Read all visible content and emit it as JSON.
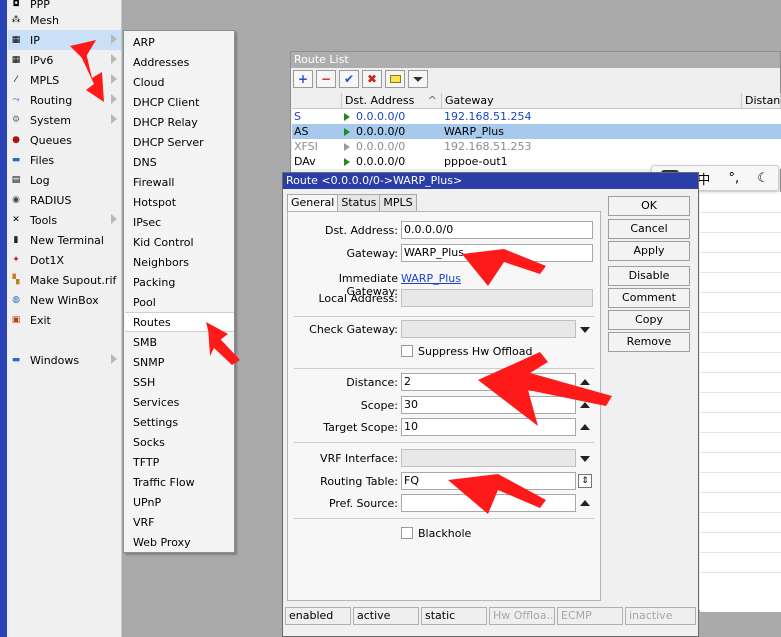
{
  "left_menu": {
    "items": [
      {
        "label": "PPP",
        "icon": "ppp-icon"
      },
      {
        "label": "Mesh",
        "icon": "mesh-icon"
      },
      {
        "label": "IP",
        "icon": "ip-icon",
        "submenu": true
      },
      {
        "label": "IPv6",
        "icon": "ipv6-icon",
        "submenu": true
      },
      {
        "label": "MPLS",
        "icon": "mpls-icon",
        "submenu": true
      },
      {
        "label": "Routing",
        "icon": "routing-icon",
        "submenu": true
      },
      {
        "label": "System",
        "icon": "system-icon",
        "submenu": true
      },
      {
        "label": "Queues",
        "icon": "queues-icon"
      },
      {
        "label": "Files",
        "icon": "files-icon"
      },
      {
        "label": "Log",
        "icon": "log-icon"
      },
      {
        "label": "RADIUS",
        "icon": "radius-icon"
      },
      {
        "label": "Tools",
        "icon": "tools-icon",
        "submenu": true
      },
      {
        "label": "New Terminal",
        "icon": "terminal-icon"
      },
      {
        "label": "Dot1X",
        "icon": "dot1x-icon"
      },
      {
        "label": "Make Supout.rif",
        "icon": "supout-icon"
      },
      {
        "label": "New WinBox",
        "icon": "winbox-icon"
      },
      {
        "label": "Exit",
        "icon": "exit-icon"
      },
      {
        "label": "Windows",
        "icon": "windows-icon",
        "submenu": true
      }
    ]
  },
  "ip_submenu": {
    "items": [
      "ARP",
      "Addresses",
      "Cloud",
      "DHCP Client",
      "DHCP Relay",
      "DHCP Server",
      "DNS",
      "Firewall",
      "Hotspot",
      "IPsec",
      "Kid Control",
      "Neighbors",
      "Packing",
      "Pool",
      "Routes",
      "SMB",
      "SNMP",
      "SSH",
      "Services",
      "Settings",
      "Socks",
      "TFTP",
      "Traffic Flow",
      "UPnP",
      "VRF",
      "Web Proxy"
    ]
  },
  "route_list": {
    "title": "Route List",
    "columns": [
      "",
      "Dst. Address",
      "Gateway",
      "Distance"
    ],
    "rows": [
      {
        "flag": "S",
        "dst": "0.0.0.0/0",
        "gateway": "192.168.51.254"
      },
      {
        "flag": "AS",
        "dst": "0.0.0.0/0",
        "gateway": "WARP_Plus"
      },
      {
        "flag": "XFSI",
        "dst": "0.0.0.0/0",
        "gateway": "192.168.51.253"
      },
      {
        "flag": "DAv",
        "dst": "0.0.0.0/0",
        "gateway": "pppoe-out1"
      }
    ]
  },
  "ime": {
    "logo": "dts",
    "mode": "中",
    "punct": "°,",
    "theme": "moon-icon"
  },
  "route_dialog": {
    "title": "Route <0.0.0.0/0->WARP_Plus>",
    "tabs": [
      "General",
      "Status",
      "MPLS"
    ],
    "fields": {
      "dst_label": "Dst. Address:",
      "dst_value": "0.0.0.0/0",
      "gw_label": "Gateway:",
      "gw_value": "WARP_Plus",
      "imm_gw_label": "Immediate Gateway:",
      "imm_gw_value": "WARP_Plus",
      "local_label": "Local Address:",
      "local_value": "",
      "check_gw_label": "Check Gateway:",
      "check_gw_value": "",
      "suppress_label": "Suppress Hw Offload",
      "distance_label": "Distance:",
      "distance_value": "2",
      "scope_label": "Scope:",
      "scope_value": "30",
      "target_scope_label": "Target Scope:",
      "target_scope_value": "10",
      "vrf_label": "VRF Interface:",
      "vrf_value": "",
      "rt_label": "Routing Table:",
      "rt_value": "FQ",
      "pref_label": "Pref. Source:",
      "pref_value": "",
      "blackhole_label": "Blackhole"
    },
    "buttons": [
      "OK",
      "Cancel",
      "Apply",
      "Disable",
      "Comment",
      "Copy",
      "Remove"
    ],
    "status": [
      "enabled",
      "active",
      "static",
      "Hw Offloa...",
      "ECMP",
      "inactive"
    ]
  },
  "colors": {
    "title_active": "#2b3ea8",
    "selected_row": "#a7c9ec",
    "link": "#1c44c8",
    "arrow": "#ff0000"
  }
}
